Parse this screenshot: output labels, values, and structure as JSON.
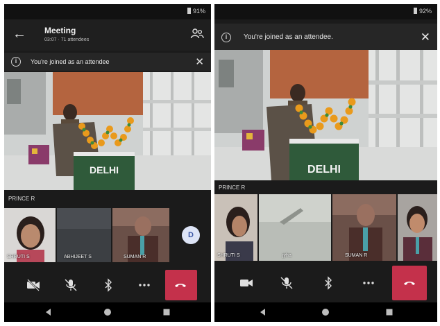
{
  "left_phone": {
    "status": {
      "battery": "91%"
    },
    "header": {
      "title": "Meeting",
      "subtitle": "03:07 · 71 attendees"
    },
    "banner": {
      "text": "You're joined as an attendee"
    },
    "presenter": {
      "name": "PRINCE R"
    },
    "tiles": [
      {
        "name": "SHRUTI S"
      },
      {
        "name": "ABHIJEET S"
      },
      {
        "name": "SUMAN R"
      }
    ],
    "avatar": {
      "initial": "D"
    }
  },
  "right_phone": {
    "status": {
      "battery": "92%"
    },
    "banner": {
      "text": "You're joined as an attendee."
    },
    "presenter": {
      "name": "PRINCE R"
    },
    "tiles": [
      {
        "name": "SHRUTI S"
      },
      {
        "name": "jyha"
      },
      {
        "name": "SUMAN R"
      },
      {
        "name": ""
      }
    ]
  },
  "stage": {
    "sign_text_line1": "DELHI",
    "sign_text_line2": ""
  },
  "colors": {
    "hangup": "#c4314b",
    "background": "#1b1b1b",
    "avatar_bg": "#dde4f6",
    "avatar_fg": "#3d58a6"
  },
  "icons": {
    "header": [
      "back-icon",
      "people-icon"
    ],
    "controls": [
      "camera-icon",
      "mic-off-icon",
      "bluetooth-icon",
      "more-icon",
      "hangup-icon"
    ],
    "nav": [
      "nav-back-icon",
      "nav-home-icon",
      "nav-recents-icon"
    ]
  }
}
